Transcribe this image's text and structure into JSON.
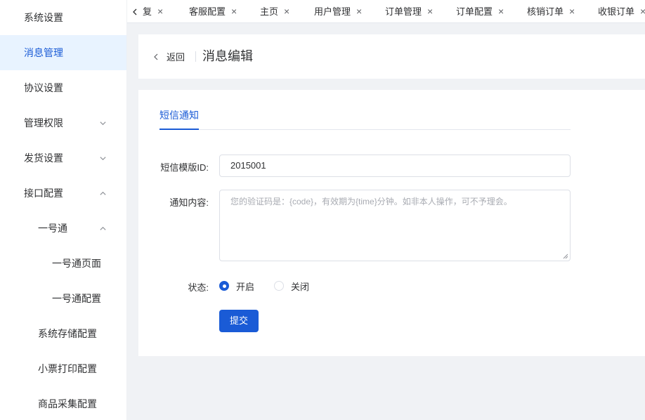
{
  "sidebar": {
    "items": [
      {
        "label": "系统设置"
      },
      {
        "label": "消息管理"
      },
      {
        "label": "协议设置"
      },
      {
        "label": "管理权限"
      },
      {
        "label": "发货设置"
      },
      {
        "label": "接口配置"
      },
      {
        "label": "一号通"
      },
      {
        "label": "一号通页面"
      },
      {
        "label": "一号通配置"
      },
      {
        "label": "系统存储配置"
      },
      {
        "label": "小票打印配置"
      },
      {
        "label": "商品采集配置"
      }
    ]
  },
  "tabs": [
    {
      "label": "复"
    },
    {
      "label": "客服配置"
    },
    {
      "label": "主页"
    },
    {
      "label": "用户管理"
    },
    {
      "label": "订单管理"
    },
    {
      "label": "订单配置"
    },
    {
      "label": "核销订单"
    },
    {
      "label": "收银订单"
    }
  ],
  "tab_close_glyph": "×",
  "header": {
    "back_label": "返回",
    "title": "消息编辑"
  },
  "form": {
    "tab_label": "短信通知",
    "template_id_label": "短信模版ID:",
    "template_id_value": "2015001",
    "content_label": "通知内容:",
    "content_placeholder": "您的验证码是：{code}，有效期为{time}分钟。如非本人操作，可不予理会。",
    "status_label": "状态:",
    "status_on": "开启",
    "status_off": "关闭",
    "status_selected": "开启",
    "submit_label": "提交"
  },
  "colors": {
    "primary": "#1a5bd6",
    "active_bg": "#e8f3ff",
    "page_bg": "#f0f2f5"
  }
}
